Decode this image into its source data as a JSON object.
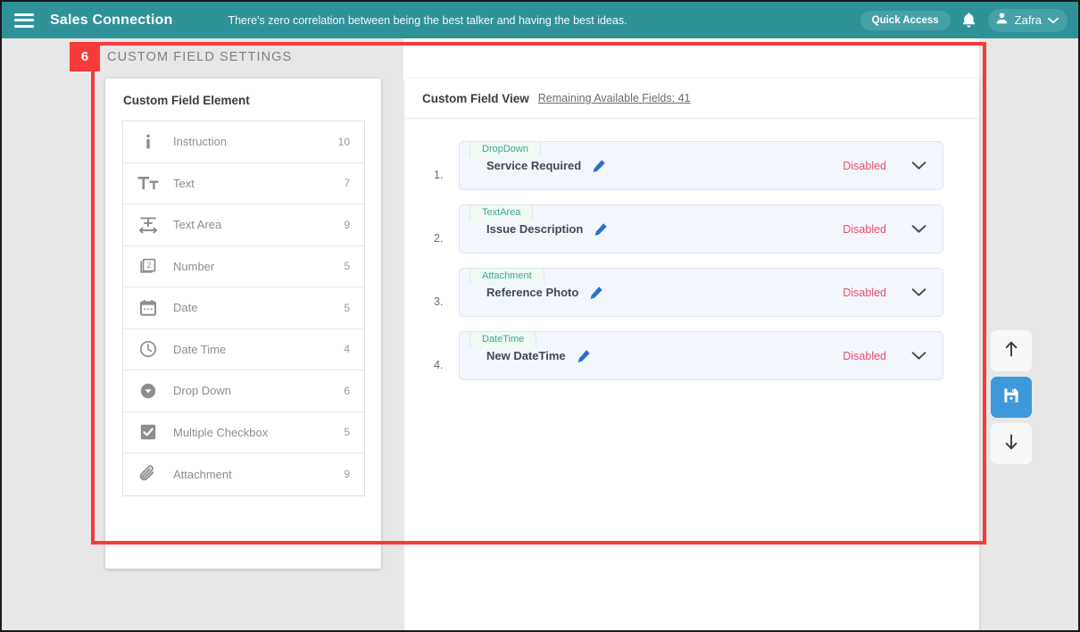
{
  "topbar": {
    "menu_icon": "hamburger-icon",
    "brand": "Sales Connection",
    "tagline": "There's zero correlation between being the best talker and having the best ideas.",
    "quick_access_label": "Quick Access",
    "notification_icon": "bell-icon",
    "user_name": "Zafra",
    "user_icon": "person-icon",
    "chevron_icon": "chevron-down-icon",
    "bar_color": "#2f9299",
    "pill_color": "#46a1a7"
  },
  "annotation": {
    "badge_number": "6",
    "highlight_color": "#f73a3a"
  },
  "page": {
    "title": "CUSTOM FIELD SETTINGS"
  },
  "left_panel": {
    "title": "Custom Field Element",
    "items": [
      {
        "icon": "info-icon",
        "label": "Instruction",
        "count": "10"
      },
      {
        "icon": "text-format-icon",
        "label": "Text",
        "count": "7"
      },
      {
        "icon": "text-area-icon",
        "label": "Text Area",
        "count": "9"
      },
      {
        "icon": "number-icon",
        "label": "Number",
        "count": "5"
      },
      {
        "icon": "calendar-icon",
        "label": "Date",
        "count": "5"
      },
      {
        "icon": "clock-icon",
        "label": "Date Time",
        "count": "4"
      },
      {
        "icon": "dropdown-circle-icon",
        "label": "Drop Down",
        "count": "6"
      },
      {
        "icon": "checkbox-icon",
        "label": "Multiple Checkbox",
        "count": "5"
      },
      {
        "icon": "paperclip-icon",
        "label": "Attachment",
        "count": "9"
      }
    ]
  },
  "right_panel": {
    "title": "Custom Field View",
    "remaining_link": "Remaining Available Fields: 41",
    "fields": [
      {
        "index": "1.",
        "type": "DropDown",
        "name": "Service Required",
        "edit_icon": "pencil-icon",
        "status": "Disabled",
        "chevron": "chevron-down-icon"
      },
      {
        "index": "2.",
        "type": "TextArea",
        "name": "Issue Description",
        "edit_icon": "pencil-icon",
        "status": "Disabled",
        "chevron": "chevron-down-icon"
      },
      {
        "index": "3.",
        "type": "Attachment",
        "name": "Reference Photo",
        "edit_icon": "pencil-icon",
        "status": "Disabled",
        "chevron": "chevron-down-icon"
      },
      {
        "index": "4.",
        "type": "DateTime",
        "name": "New DateTime",
        "edit_icon": "pencil-icon",
        "status": "Disabled",
        "chevron": "chevron-down-icon"
      }
    ],
    "status_color": "#ea4c6e",
    "tag_color": "#3fa39b"
  },
  "side_actions": [
    {
      "icon": "arrow-up-icon",
      "style": "plain"
    },
    {
      "icon": "save-icon",
      "style": "blue"
    },
    {
      "icon": "arrow-down-icon",
      "style": "plain"
    }
  ]
}
